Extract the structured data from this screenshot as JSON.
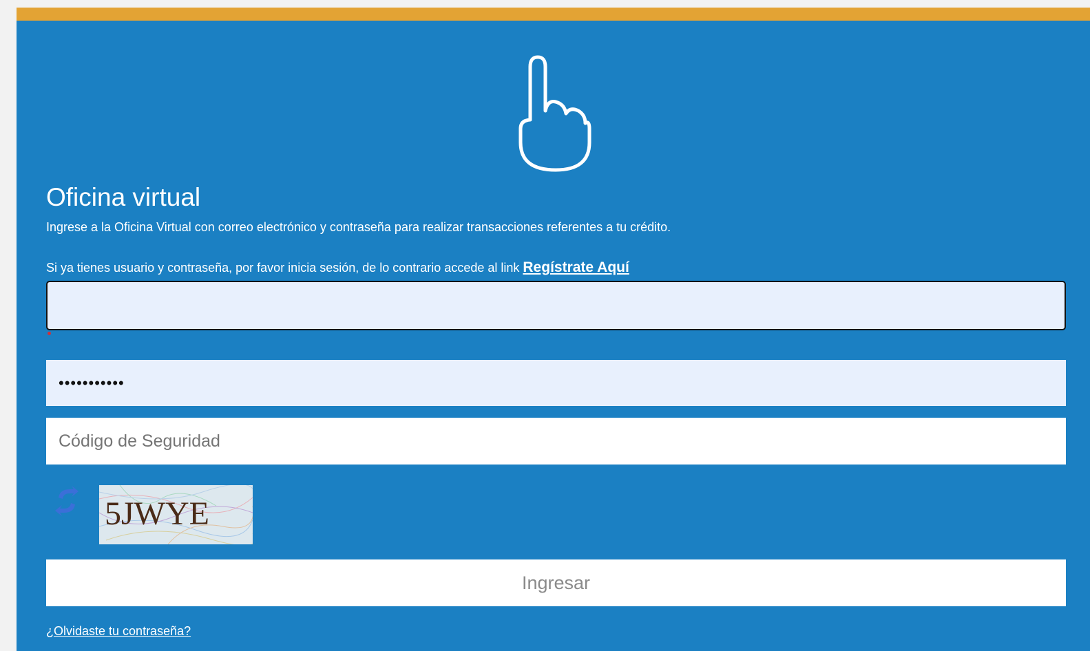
{
  "header": {
    "accent_color": "#e3a334",
    "panel_color": "#1b80c3",
    "icon": "pointing-hand-icon"
  },
  "login": {
    "title": "Oficina virtual",
    "subtitle": "Ingrese a la Oficina Virtual con correo electrónico y contraseña para realizar transacciones referentes a tu crédito.",
    "register_prompt": "Si ya tienes usuario y contraseña, por favor inicia sesión, de lo contrario accede al link",
    "register_link": "Regístrate Aquí",
    "email_value": "",
    "password_value": "•••••••••••",
    "security_code_placeholder": "Código de Seguridad",
    "refresh_icon": "refresh-icon",
    "captcha_text": "5JWYE",
    "submit_label": "Ingresar",
    "forgot_password_link": "¿Olvidaste tu contraseña?"
  }
}
